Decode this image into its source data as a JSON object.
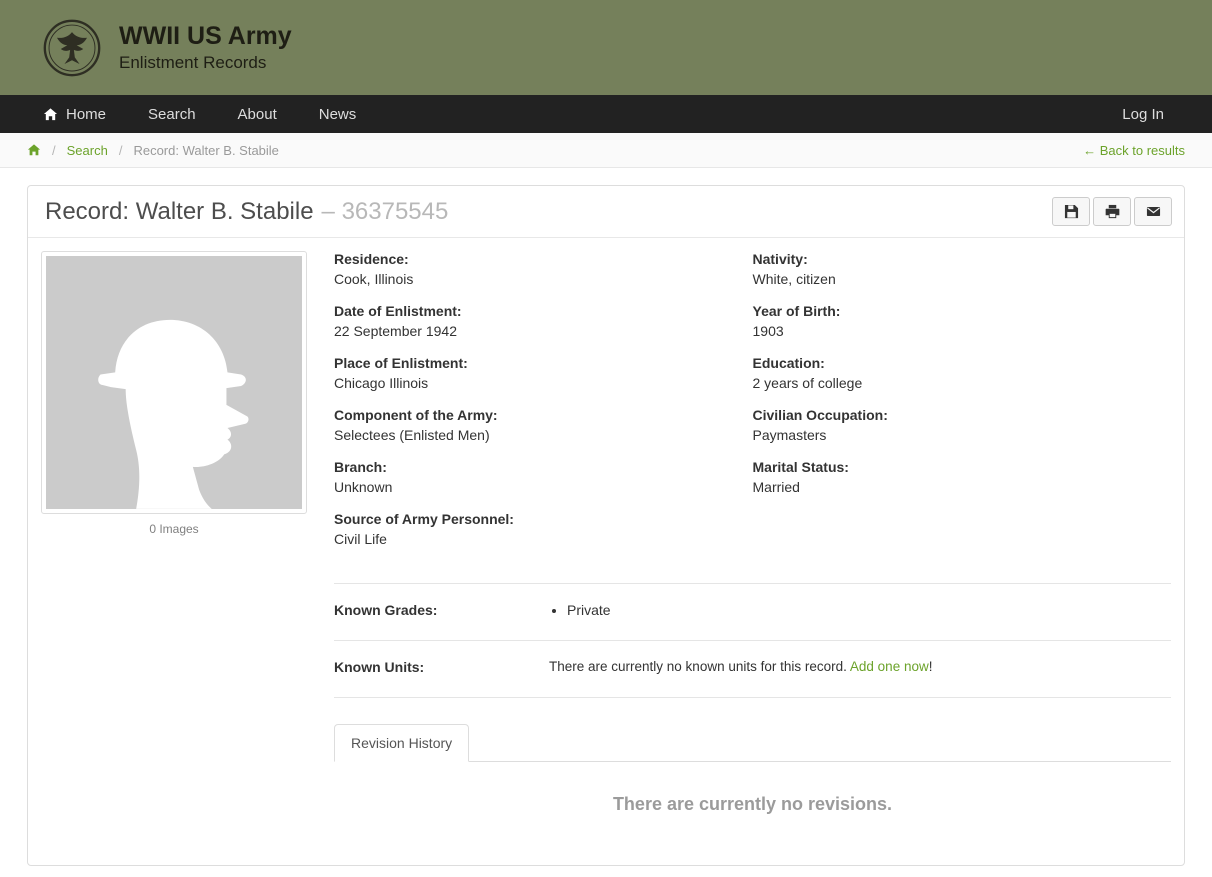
{
  "colors": {
    "header_bg": "#75805b",
    "nav_bg": "#222222",
    "accent_green": "#6ca32b",
    "photo_bg": "#cbcbcb"
  },
  "header": {
    "title": "WWII US Army",
    "subtitle": "Enlistment Records"
  },
  "nav": {
    "items": [
      "Home",
      "Search",
      "About",
      "News"
    ],
    "login": "Log In"
  },
  "breadcrumb": {
    "sep": "/",
    "search": "Search",
    "current": "Record: Walter B. Stabile",
    "back": "← Back to results"
  },
  "record": {
    "title": "Record: Walter B. Stabile",
    "serial": "– 36375545",
    "images_caption": "0 Images",
    "fields_left": [
      {
        "label": "Residence:",
        "value": "Cook, Illinois"
      },
      {
        "label": "Date of Enlistment:",
        "value": "22 September 1942"
      },
      {
        "label": "Place of Enlistment:",
        "value": "Chicago Illinois"
      },
      {
        "label": "Component of the Army:",
        "value": "Selectees (Enlisted Men)"
      },
      {
        "label": "Branch:",
        "value": "Unknown"
      },
      {
        "label": "Source of Army Personnel:",
        "value": "Civil Life"
      }
    ],
    "fields_right": [
      {
        "label": "Nativity:",
        "value": "White, citizen"
      },
      {
        "label": "Year of Birth:",
        "value": "1903"
      },
      {
        "label": "Education:",
        "value": "2 years of college"
      },
      {
        "label": "Civilian Occupation:",
        "value": "Paymasters"
      },
      {
        "label": "Marital Status:",
        "value": "Married"
      }
    ],
    "grades": {
      "label": "Known Grades:",
      "items": [
        "Private"
      ]
    },
    "units": {
      "label": "Known Units:",
      "empty_text": "There are currently no known units for this record.",
      "link": "Add one now",
      "suffix": "!"
    },
    "tab_label": "Revision History",
    "revisions_empty": "There are currently no revisions."
  }
}
